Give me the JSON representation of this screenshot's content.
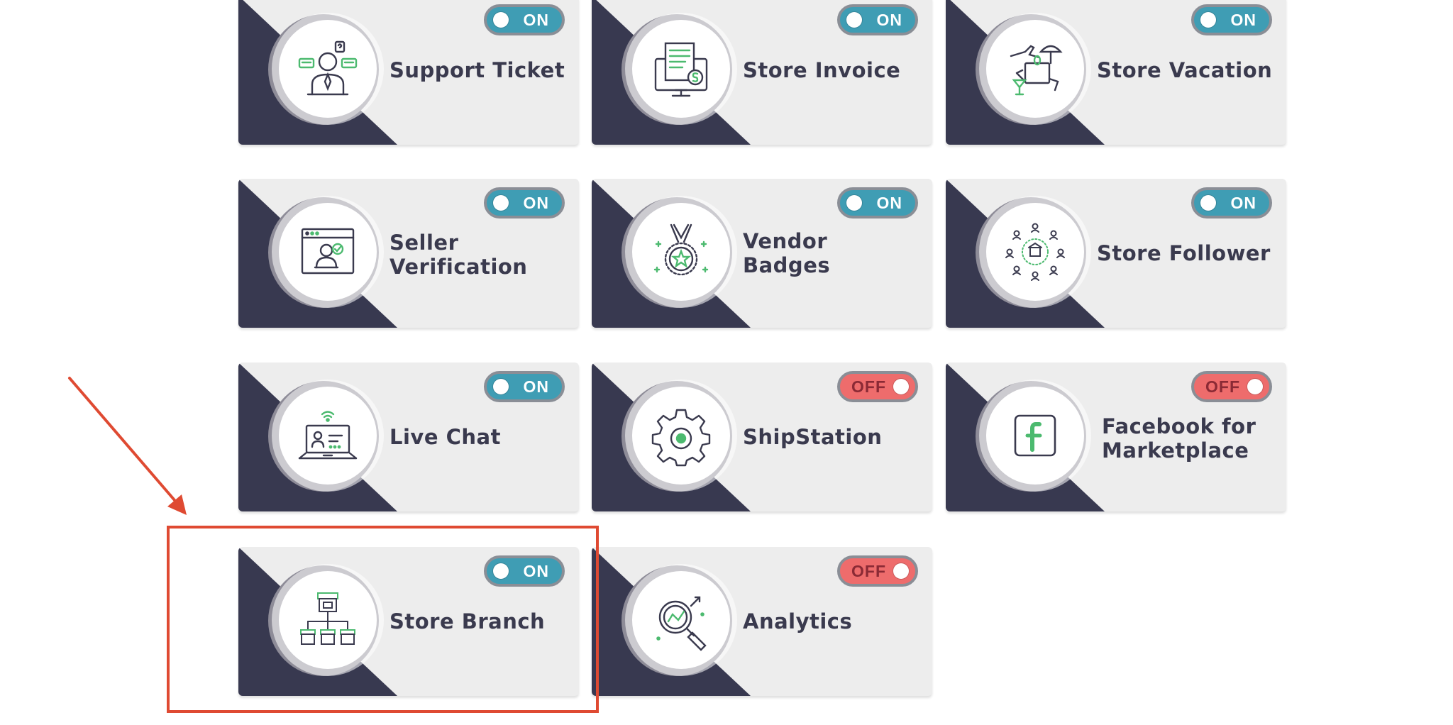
{
  "colors": {
    "dark_triangle": "#383950",
    "card_bg": "#ededed",
    "toggle_on": "#3f9db4",
    "toggle_off": "#ee6c6c",
    "annotation": "#df4a32",
    "icon_stroke": "#3a3a4e",
    "icon_accent": "#4cba6f"
  },
  "modules": [
    {
      "title": "Support Ticket",
      "state": "on",
      "toggle_label": "ON",
      "icon": "support-agent-icon"
    },
    {
      "title": "Store Invoice",
      "state": "on",
      "toggle_label": "ON",
      "icon": "invoice-icon"
    },
    {
      "title": "Store Vacation",
      "state": "on",
      "toggle_label": "ON",
      "icon": "vacation-icon"
    },
    {
      "title": "Seller Verification",
      "state": "on",
      "toggle_label": "ON",
      "icon": "verification-icon"
    },
    {
      "title": "Vendor Badges",
      "state": "on",
      "toggle_label": "ON",
      "icon": "badge-medal-icon"
    },
    {
      "title": "Store Follower",
      "state": "on",
      "toggle_label": "ON",
      "icon": "follower-network-icon"
    },
    {
      "title": "Live Chat",
      "state": "on",
      "toggle_label": "ON",
      "icon": "live-chat-laptop-icon"
    },
    {
      "title": "ShipStation",
      "state": "off",
      "toggle_label": "OFF",
      "icon": "gear-icon"
    },
    {
      "title": "Facebook for Marketplace",
      "state": "off",
      "toggle_label": "OFF",
      "icon": "facebook-icon"
    },
    {
      "title": "Store Branch",
      "state": "on",
      "toggle_label": "ON",
      "icon": "store-branch-icon"
    },
    {
      "title": "Analytics",
      "state": "off",
      "toggle_label": "OFF",
      "icon": "analytics-magnifier-icon"
    }
  ]
}
